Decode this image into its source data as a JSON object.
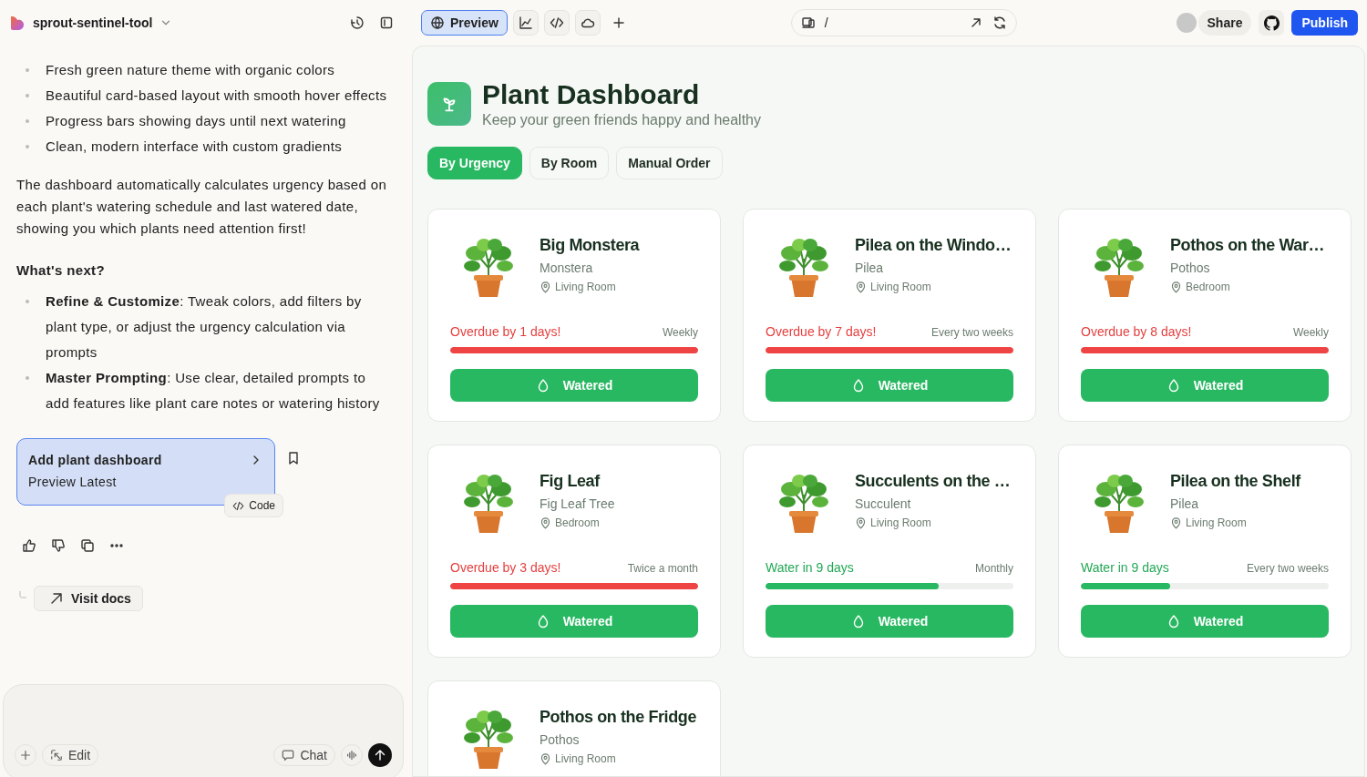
{
  "project": {
    "name": "sprout-sentinel-tool"
  },
  "view_tabs": [
    {
      "kind": "preview",
      "label": "Preview",
      "selected": true
    },
    {
      "kind": "chart",
      "selected": false
    },
    {
      "kind": "code",
      "selected": false
    },
    {
      "kind": "cloud",
      "selected": false
    }
  ],
  "address_bar": {
    "path": "/"
  },
  "header_actions": {
    "share": "Share",
    "publish": "Publish"
  },
  "chat": {
    "features": [
      "Fresh green nature theme with organic colors",
      "Beautiful card-based layout with smooth hover effects",
      "Progress bars showing days until next watering",
      "Clean, modern interface with custom gradients"
    ],
    "paragraph": "The dashboard automatically calculates urgency based on each plant's watering schedule and last watered date, showing you which plants need attention first!",
    "next_heading": "What's next?",
    "next_steps": [
      "**Refine & Customize**: Tweak colors, add filters by plant type, or adjust the urgency calculation via prompts",
      "**Master Prompting**: Use clear, detailed prompts to add features like plant care notes or watering history"
    ],
    "version_card": {
      "title": "Add plant dashboard",
      "subtitle": "Preview Latest",
      "code_label": "Code"
    },
    "docs_link": "Visit docs",
    "composer": {
      "edit": "Edit",
      "chat": "Chat"
    }
  },
  "dashboard": {
    "title": "Plant Dashboard",
    "subtitle": "Keep your green friends happy and healthy",
    "sort_tabs": [
      {
        "label": "By Urgency",
        "selected": true
      },
      {
        "label": "By Room",
        "selected": false
      },
      {
        "label": "Manual Order",
        "selected": false
      }
    ],
    "plants": [
      {
        "name": "Big Monstera",
        "species": "Monstera",
        "room": "Living Room",
        "kind": "overdue",
        "status": "Overdue by 1 days!",
        "schedule": "Weekly",
        "level": 1,
        "button": "Watered"
      },
      {
        "name": "Pilea on the Windo…",
        "species": "Pilea",
        "room": "Living Room",
        "kind": "overdue",
        "status": "Overdue by 7 days!",
        "schedule": "Every two weeks",
        "level": 1,
        "button": "Watered"
      },
      {
        "name": "Pothos on the War…",
        "species": "Pothos",
        "room": "Bedroom",
        "kind": "overdue",
        "status": "Overdue by 8 days!",
        "schedule": "Weekly",
        "level": 1,
        "button": "Watered"
      },
      {
        "name": "Fig Leaf",
        "species": "Fig Leaf Tree",
        "room": "Bedroom",
        "kind": "overdue",
        "status": "Overdue by 3 days!",
        "schedule": "Twice a month",
        "level": 1,
        "button": "Watered"
      },
      {
        "name": "Succulents on the …",
        "species": "Succulent",
        "room": "Living Room",
        "kind": "upcoming",
        "status": "Water in 9 days",
        "schedule": "Monthly",
        "level": 0.7,
        "button": "Watered"
      },
      {
        "name": "Pilea on the Shelf",
        "species": "Pilea",
        "room": "Living Room",
        "kind": "upcoming",
        "status": "Water in 9 days",
        "schedule": "Every two weeks",
        "level": 0.36,
        "button": "Watered"
      },
      {
        "name": "Pothos on the Fridge",
        "species": "Pothos",
        "room": "Living Room"
      }
    ]
  }
}
